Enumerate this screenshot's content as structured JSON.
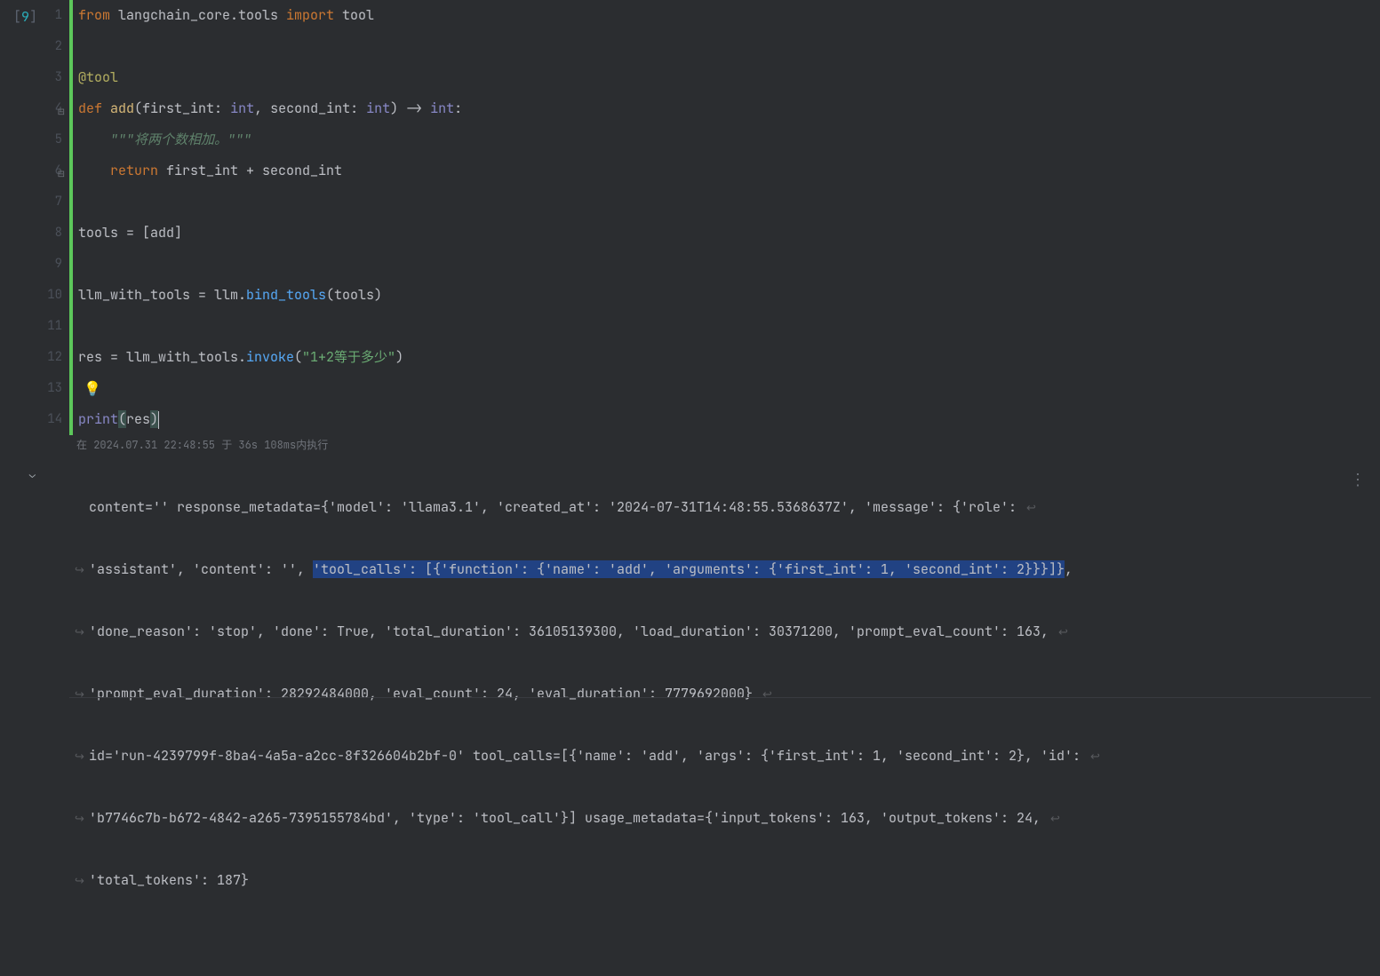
{
  "cell": {
    "execution_count_open": "[",
    "execution_count_num": "9",
    "execution_count_close": "]",
    "line_numbers": [
      "1",
      "2",
      "3",
      "4",
      "5",
      "6",
      "7",
      "8",
      "9",
      "10",
      "11",
      "12",
      "13",
      "14"
    ]
  },
  "code": {
    "l1_from": "from",
    "l1_mod": " langchain_core.tools ",
    "l1_import": "import",
    "l1_tool": " tool",
    "l3_dec": "@tool",
    "l4_def": "def ",
    "l4_name": "add",
    "l4_p_open": "(",
    "l4_arg1": "first_int: ",
    "l4_type1": "int",
    "l4_comma1": ", ",
    "l4_arg2": "second_int: ",
    "l4_type2": "int",
    "l4_p_close": ") -> ",
    "l4_ret": "int",
    "l4_colon": ":",
    "l5_doc": "    \"\"\"将两个数相加。\"\"\"",
    "l6_indent": "    ",
    "l6_return": "return",
    "l6_expr": " first_int + second_int",
    "l8": "tools = [add]",
    "l10": "llm_with_tools = llm.bind_tools(tools)",
    "l10_pre": "llm_with_tools = llm.",
    "l10_call": "bind_tools",
    "l10_args": "(tools)",
    "l12_pre": "res = llm_with_tools.",
    "l12_call": "invoke",
    "l12_p": "(",
    "l12_str": "\"1+2等于多少\"",
    "l12_pc": ")",
    "l14_print": "print",
    "l14_p": "(",
    "l14_arg": "res",
    "l14_pc": ")"
  },
  "exec_info": "在 2024.07.31 22:48:55 于 36s 108ms内执行",
  "output": {
    "l1": "content='' response_metadata={'model': 'llama3.1', 'created_at': '2024-07-31T14:48:55.5368637Z', 'message': {'role': ",
    "l2_pre": "'assistant', 'content': '', ",
    "l2_hl": "'tool_calls': [{'function': {'name': 'add', 'arguments': {'first_int': 1, 'second_int': 2}}}]}",
    "l2_post": ", ",
    "l3": "'done_reason': 'stop', 'done': True, 'total_duration': 36105139300, 'load_duration': 30371200, 'prompt_eval_count': 163, ",
    "l4": "'prompt_eval_duration': 28292484000, 'eval_count': 24, 'eval_duration': 7779692000} ",
    "l5": "id='run-4239799f-8ba4-4a5a-a2cc-8f326604b2bf-0' tool_calls=[{'name': 'add', 'args': {'first_int': 1, 'second_int': 2}, 'id': ",
    "l6": "'b7746c7b-b672-4842-a265-7395155784bd', 'type': 'tool_call'}] usage_metadata={'input_tokens': 163, 'output_tokens': 24, ",
    "l7": "'total_tokens': 187}"
  },
  "chart_data": null
}
